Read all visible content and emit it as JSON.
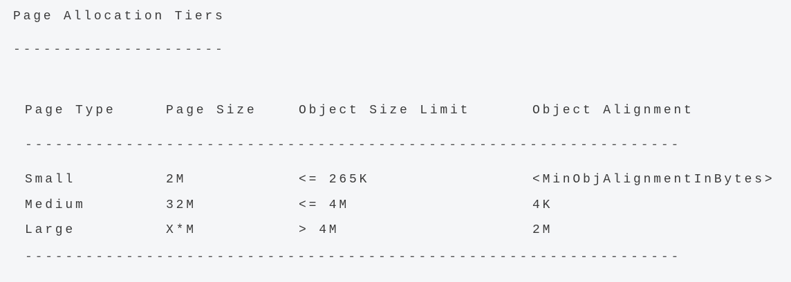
{
  "title": "Page Allocation Tiers",
  "title_rule": "---------------------",
  "table": {
    "headers": [
      "Page Type",
      "Page Size",
      "Object Size Limit",
      "Object Alignment"
    ],
    "rule": "-----------------------------------------------------------------",
    "rows": [
      [
        "Small",
        "2M",
        "<= 265K",
        "<MinObjAlignmentInBytes>"
      ],
      [
        "Medium",
        "32M",
        "<= 4M",
        "4K"
      ],
      [
        "Large",
        "X*M",
        "> 4M",
        "2M"
      ]
    ]
  }
}
